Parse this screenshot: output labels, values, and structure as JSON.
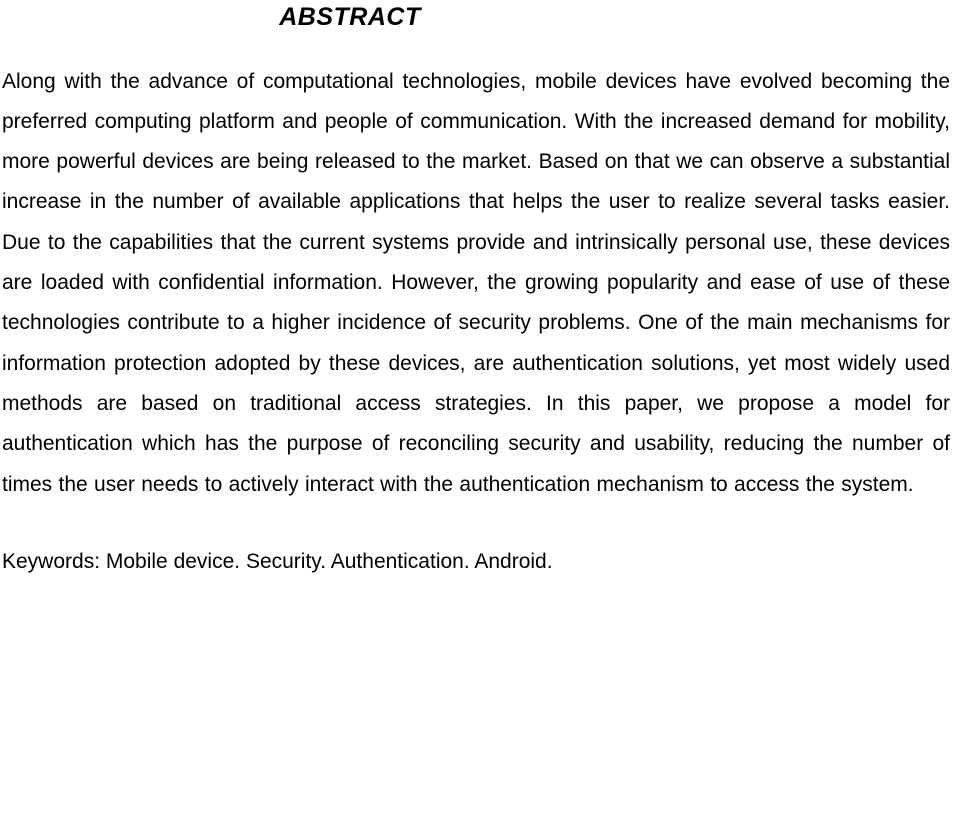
{
  "document": {
    "heading": "ABSTRACT",
    "abstract_text": "Along with the advance of computational technologies, mobile devices have evolved becoming the preferred computing platform and people of communication.  With the increased demand for mobility, more powerful devices are being released to the market.  Based on that we can observe a substantial increase in the number of available applications that helps the user to realize several tasks easier.  Due to the capabilities that the current systems provide and intrinsically personal use, these devices are loaded with confidential information.  However, the growing popularity and ease of use of these technologies contribute to a higher incidence of security problems.  One of the main mechanisms for information protection adopted by these devices, are authentication solutions, yet most widely used methods are based on traditional access strategies.  In this paper, we propose a model for authentication which has the purpose of reconciling security and usability, reducing the number of times the user needs to actively interact with the authentication mechanism to access the system.",
    "keywords_line": "Keywords: Mobile device. Security. Authentication. Android."
  }
}
